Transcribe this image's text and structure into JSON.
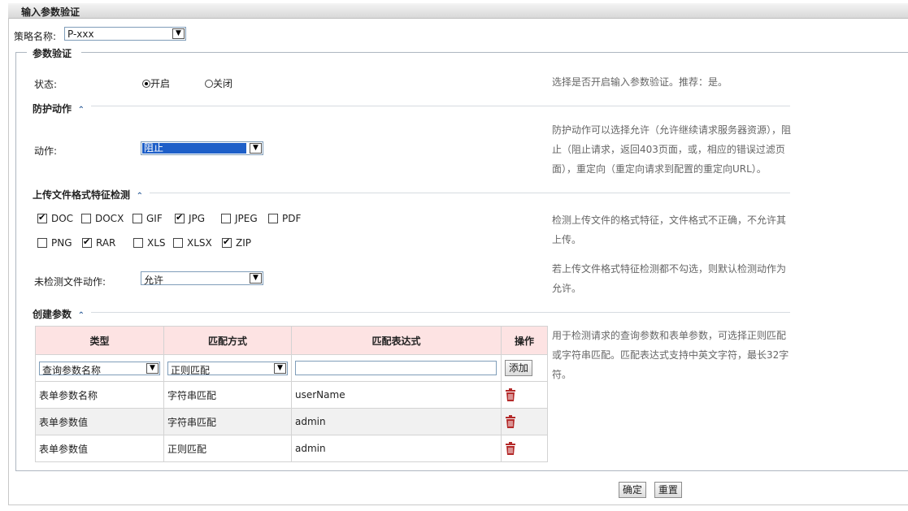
{
  "page": {
    "title": "输入参数验证"
  },
  "policy": {
    "label": "策略名称:",
    "value": "P-xxx"
  },
  "fieldset": {
    "legend": "参数验证"
  },
  "status": {
    "label": "状态:",
    "on_label": "开启",
    "off_label": "关闭",
    "selected": "on",
    "help": "选择是否开启输入参数验证。推荐：是。"
  },
  "protection": {
    "heading": "防护动作",
    "action_label": "动作:",
    "action_value": "阻止",
    "help": "防护动作可以选择允许（允许继续请求服务器资源），阻止（阻止请求，返回403页面，或，相应的错误过滤页面），重定向（重定向请求到配置的重定向URL）。"
  },
  "upload": {
    "heading": "上传文件格式特征检测",
    "formats": [
      {
        "name": "DOC",
        "checked": true
      },
      {
        "name": "DOCX",
        "checked": false
      },
      {
        "name": "GIF",
        "checked": false
      },
      {
        "name": "JPG",
        "checked": true
      },
      {
        "name": "JPEG",
        "checked": false
      },
      {
        "name": "PDF",
        "checked": false
      },
      {
        "name": "PNG",
        "checked": false
      },
      {
        "name": "RAR",
        "checked": true
      },
      {
        "name": "XLS",
        "checked": false
      },
      {
        "name": "XLSX",
        "checked": false
      },
      {
        "name": "ZIP",
        "checked": true
      }
    ],
    "help": "检测上传文件的格式特征，文件格式不正确，不允许其上传。",
    "undetected_label": "未检测文件动作:",
    "undetected_value": "允许",
    "undetected_help": "若上传文件格式特征检测都不勾选，则默认检测动作为允许。"
  },
  "params": {
    "heading": "创建参数",
    "columns": [
      "类型",
      "匹配方式",
      "匹配表达式",
      "操作"
    ],
    "new_row": {
      "type_value": "查询参数名称",
      "match_value": "正则匹配",
      "expression_value": "",
      "add_label": "添加"
    },
    "rows": [
      {
        "type": "表单参数名称",
        "match": "字符串匹配",
        "expression": "userName"
      },
      {
        "type": "表单参数值",
        "match": "字符串匹配",
        "expression": "admin"
      },
      {
        "type": "表单参数值",
        "match": "正则匹配",
        "expression": "admin"
      }
    ],
    "help": "用于检测请求的查询参数和表单参数，可选择正则匹配或字符串匹配。匹配表达式支持中英文字符，最长32字符。"
  },
  "footer": {
    "confirm_label": "确定",
    "reset_label": "重置"
  },
  "colors": {
    "header_bg": "#fde3e3",
    "delete_icon": "#b42a2a",
    "selected_option_bg": "#1e5fc8",
    "caret": "#2f5f9a"
  }
}
